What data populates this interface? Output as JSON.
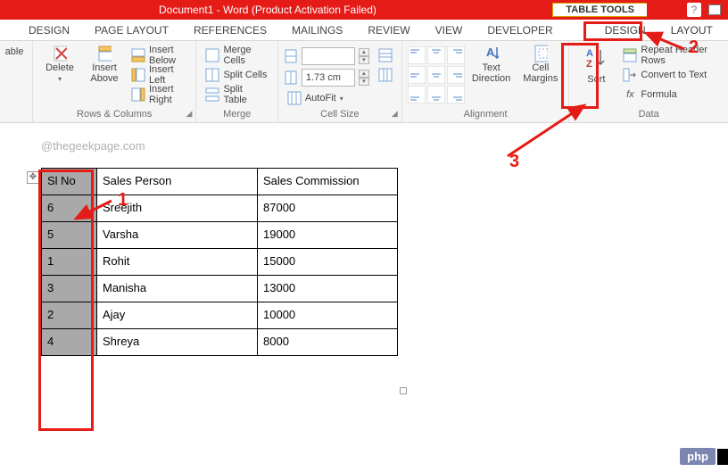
{
  "titlebar": {
    "title": "Document1 -  Word (Product Activation Failed)",
    "table_tools": "TABLE TOOLS"
  },
  "tabs": {
    "design": "DESIGN",
    "page_layout": "PAGE LAYOUT",
    "references": "REFERENCES",
    "mailings": "MAILINGS",
    "review": "REVIEW",
    "view": "VIEW",
    "developer": "DEVELOPER",
    "tt_design": "DESIGN",
    "tt_layout": "LAYOUT"
  },
  "ribbon": {
    "table_btn": "able",
    "delete": "Delete",
    "insert_above": "Insert\nAbove",
    "insert_below": "Insert Below",
    "insert_left": "Insert Left",
    "insert_right": "Insert Right",
    "rows_cols": "Rows & Columns",
    "merge_cells": "Merge Cells",
    "split_cells": "Split Cells",
    "split_table": "Split Table",
    "merge": "Merge",
    "height_val": "",
    "width_val": "1.73 cm",
    "autofit": "AutoFit",
    "cell_size": "Cell Size",
    "text_direction": "Text\nDirection",
    "cell_margins": "Cell\nMargins",
    "alignment": "Alignment",
    "sort": "Sort",
    "repeat_header": "Repeat Header Rows",
    "convert_text": "Convert to Text",
    "formula": "Formula",
    "data": "Data"
  },
  "doc": {
    "watermark": "@thegeekpage.com",
    "headers": {
      "sl": "Sl No",
      "person": "Sales Person",
      "comm": "Sales Commission"
    },
    "rows": [
      {
        "sl": "6",
        "person": "Sreejith",
        "comm": "87000"
      },
      {
        "sl": "5",
        "person": "Varsha",
        "comm": "19000"
      },
      {
        "sl": "1",
        "person": "Rohit",
        "comm": "15000"
      },
      {
        "sl": "3",
        "person": "Manisha",
        "comm": "13000"
      },
      {
        "sl": "2",
        "person": "Ajay",
        "comm": "10000"
      },
      {
        "sl": "4",
        "person": "Shreya",
        "comm": "8000"
      }
    ]
  },
  "annot": {
    "n1": "1",
    "n2": "2",
    "n3": "3"
  },
  "badge": {
    "php": "php"
  }
}
